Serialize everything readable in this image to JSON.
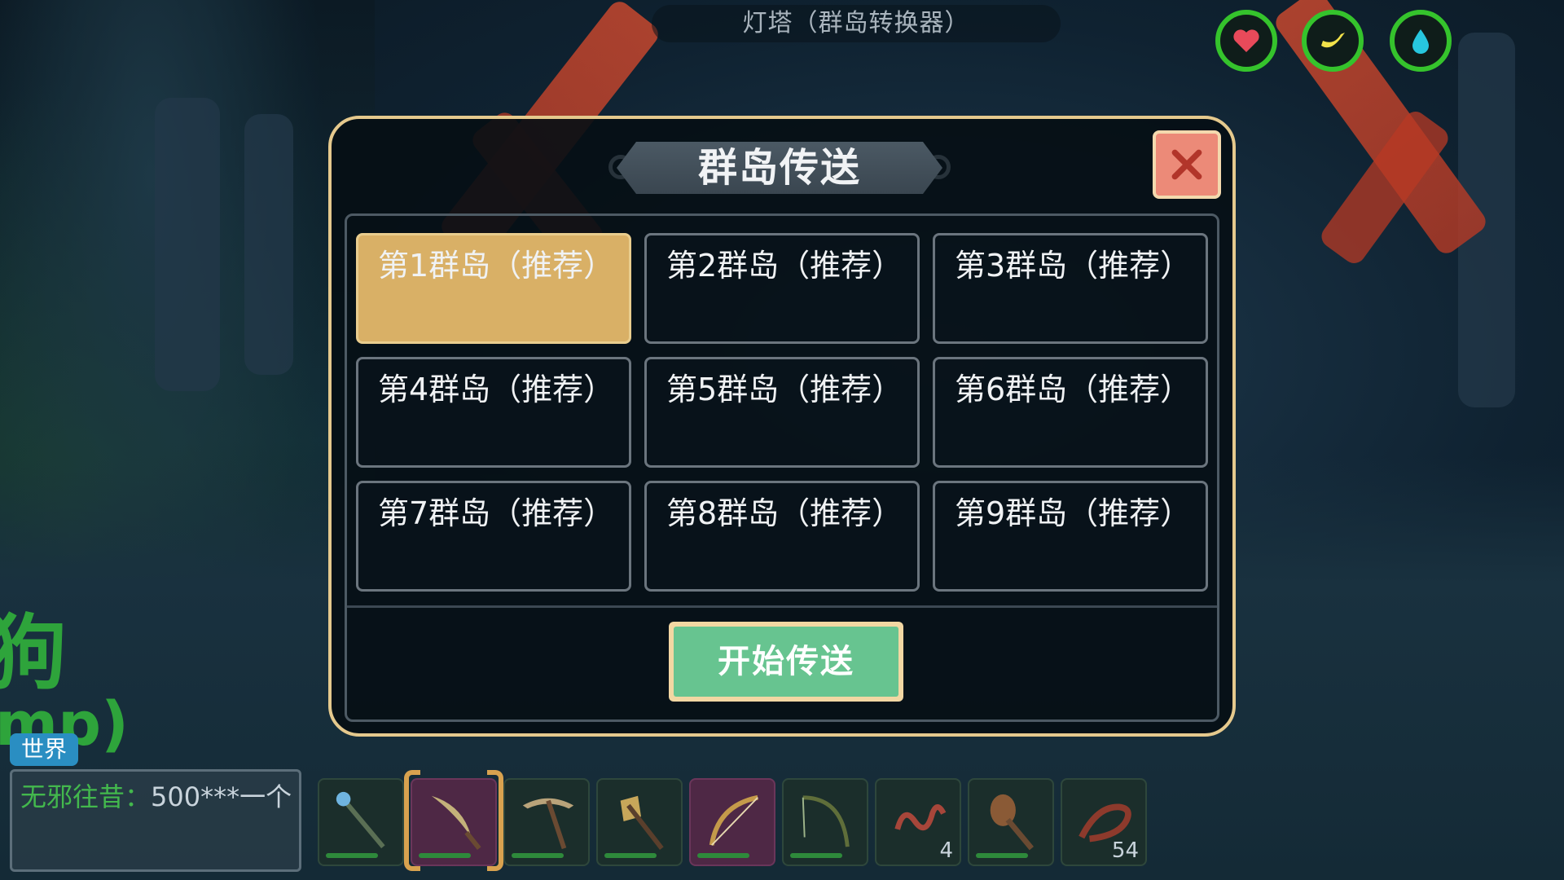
{
  "top_title": "灯塔（群岛转换器）",
  "dialog": {
    "title": "群岛传送",
    "close_label": "×",
    "islands": [
      {
        "label": "第1群岛（推荐）",
        "selected": true
      },
      {
        "label": "第2群岛（推荐）",
        "selected": false
      },
      {
        "label": "第3群岛（推荐）",
        "selected": false
      },
      {
        "label": "第4群岛（推荐）",
        "selected": false
      },
      {
        "label": "第5群岛（推荐）",
        "selected": false
      },
      {
        "label": "第6群岛（推荐）",
        "selected": false
      },
      {
        "label": "第7群岛（推荐）",
        "selected": false
      },
      {
        "label": "第8群岛（推荐）",
        "selected": false
      },
      {
        "label": "第9群岛（推荐）",
        "selected": false
      }
    ],
    "start_button": "开始传送"
  },
  "status_icons": [
    {
      "name": "heart-icon",
      "color": "#e84a5a"
    },
    {
      "name": "banana-icon",
      "color": "#f2e24a"
    },
    {
      "name": "water-drop-icon",
      "color": "#27c7df"
    }
  ],
  "chat": {
    "big_name": "狗",
    "big_sub": "mp)",
    "channel": "世界",
    "user": "无邪往昔：",
    "message": "500***一个"
  },
  "hotbar": [
    {
      "icon": "staff-icon",
      "count": "",
      "selected": false,
      "purple": false
    },
    {
      "icon": "scythe-icon",
      "count": "",
      "selected": true,
      "purple": true
    },
    {
      "icon": "pickaxe-icon",
      "count": "",
      "selected": false,
      "purple": false
    },
    {
      "icon": "battle-axe-icon",
      "count": "",
      "selected": false,
      "purple": false
    },
    {
      "icon": "bow-icon",
      "count": "",
      "selected": false,
      "purple": true
    },
    {
      "icon": "fishing-rod-icon",
      "count": "",
      "selected": false,
      "purple": false
    },
    {
      "icon": "worm-icon",
      "count": "4",
      "selected": false,
      "purple": false
    },
    {
      "icon": "club-icon",
      "count": "",
      "selected": false,
      "purple": false
    },
    {
      "icon": "rope-icon",
      "count": "54",
      "selected": false,
      "purple": false
    }
  ],
  "colors": {
    "accent_gold": "#d9b066",
    "start_green": "#67c490",
    "close_red": "#ec8a78",
    "status_ring": "#35c32c"
  }
}
